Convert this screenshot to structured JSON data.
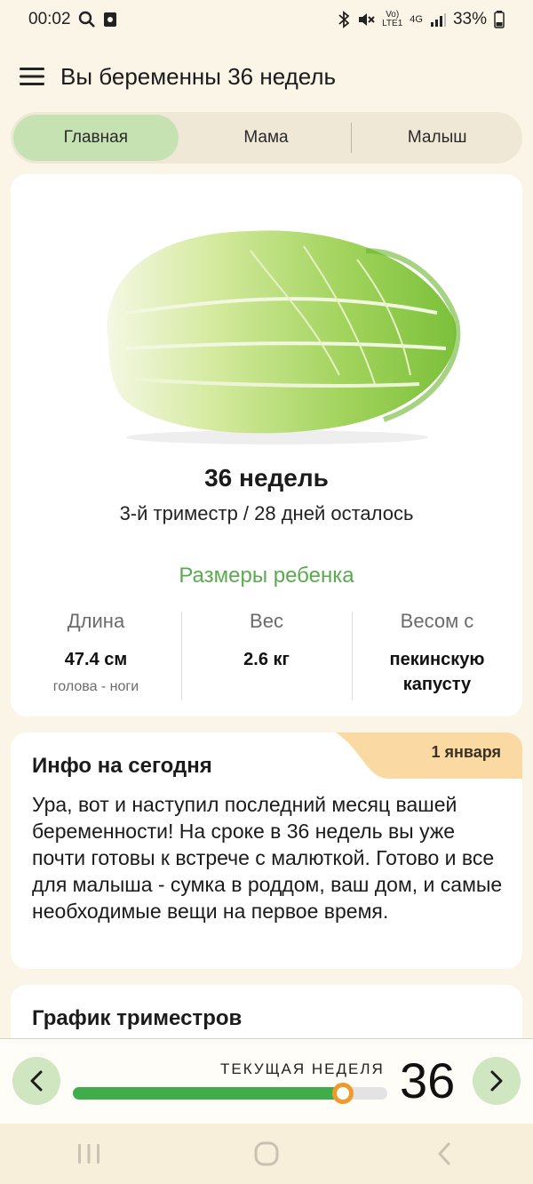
{
  "status_bar": {
    "time": "00:02",
    "battery": "33%",
    "network": "4G",
    "volte": "LTE1"
  },
  "app_bar": {
    "title": "Вы беременны 36 недель"
  },
  "tabs": [
    {
      "label": "Главная",
      "active": true
    },
    {
      "label": "Мама",
      "active": false
    },
    {
      "label": "Малыш",
      "active": false
    }
  ],
  "week_card": {
    "illustration": "chinese-cabbage",
    "week_title": "36 недель",
    "subtitle": "3-й триместр / 28 дней осталось",
    "sizes_title": "Размеры ребенка",
    "metrics": [
      {
        "label": "Длина",
        "value": "47.4 см",
        "note": "голова - ноги"
      },
      {
        "label": "Вес",
        "value": "2.6 кг",
        "note": ""
      },
      {
        "label": "Весом с",
        "value": "пекинскую капусту",
        "note": ""
      }
    ]
  },
  "info_card": {
    "title": "Инфо на сегодня",
    "date": "1 января",
    "text": "Ура, вот и наступил последний месяц вашей беременности! На сроке в 36 недель вы уже почти готовы к встрече с малюткой. Готово и все для малыша - сумка в роддом, ваш дом, и самые необходимые вещи на первое время."
  },
  "trimester_card": {
    "title": "График триместров"
  },
  "week_bar": {
    "label": "ТЕКУЩАЯ НЕДЕЛЯ",
    "week": "36",
    "progress": 0.86
  },
  "colors": {
    "accent_green": "#3fae4a",
    "tab_active": "#c6e2b3",
    "knob_orange": "#f09a2c",
    "date_flag": "#fbd9a2"
  }
}
